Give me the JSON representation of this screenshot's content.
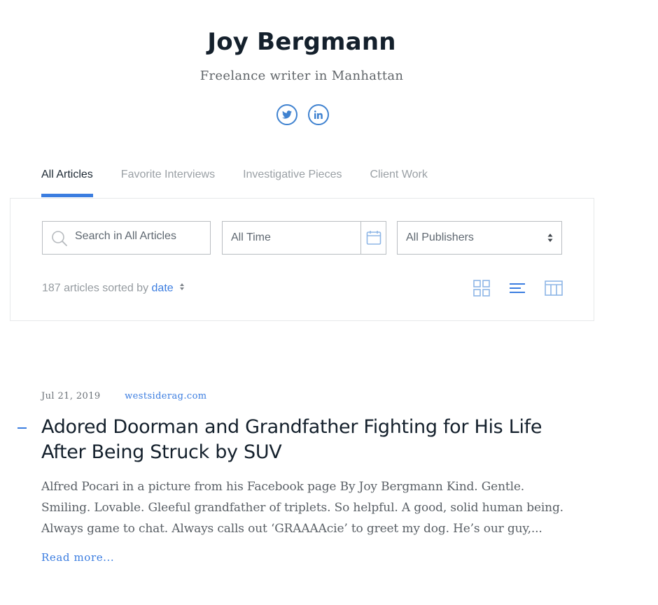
{
  "profile": {
    "name": "Joy Bergmann",
    "tagline": "Freelance writer in Manhattan",
    "social": [
      {
        "icon": "twitter-icon"
      },
      {
        "icon": "linkedin-icon"
      }
    ]
  },
  "tabs": [
    {
      "label": "All Articles",
      "active": true
    },
    {
      "label": "Favorite Interviews",
      "active": false
    },
    {
      "label": "Investigative Pieces",
      "active": false
    },
    {
      "label": "Client Work",
      "active": false
    }
  ],
  "filters": {
    "search": {
      "placeholder": "Search in All Articles",
      "value": "",
      "icon": "search-icon"
    },
    "time": {
      "value": "All Time",
      "icon": "calendar-icon"
    },
    "publisher": {
      "value": "All Publishers",
      "icon": "sort-arrows-icon"
    }
  },
  "summary": {
    "text": "187 articles sorted by",
    "sort_key": "date"
  },
  "view_modes": [
    {
      "icon": "grid-view-icon"
    },
    {
      "icon": "list-view-icon"
    },
    {
      "icon": "table-view-icon"
    }
  ],
  "article": {
    "date": "Jul 21, 2019",
    "publication": "westsiderag.com",
    "title": "Adored Doorman and Grandfather Fighting for His Life After Being Struck by SUV",
    "excerpt": "Alfred Pocari in a picture from his Facebook page By Joy Bergmann Kind. Gentle. Smiling. Lovable. Gleeful grandfather of triplets. So helpful. A good, solid human being. Always game to chat. Always calls out ‘GRAAAAcie’ to greet my dog. He’s our guy,...",
    "read_more": "Read more..."
  },
  "colors": {
    "accent": "#3b7de0",
    "heading": "#14202c",
    "muted": "#9aa0a5",
    "border": "#b9bdc1"
  }
}
